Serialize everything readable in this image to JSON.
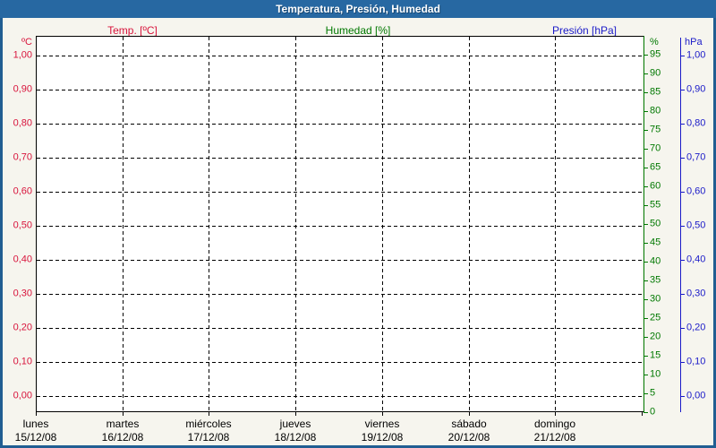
{
  "window": {
    "title": "Temperatura, Presión, Humedad"
  },
  "colors": {
    "titlebar": "#2768a2",
    "window_border": "#215e92",
    "background": "#f6f5ee",
    "plot_background": "#ffffff",
    "grid": "#000000",
    "temperature": "#d8143c",
    "humidity": "#007800",
    "pressure": "#1a1ac8"
  },
  "legend": {
    "items": [
      {
        "label": "Temp. [ºC]",
        "series": "temperature"
      },
      {
        "label": "Humedad [%]",
        "series": "humidity"
      },
      {
        "label": "Presión [hPa]",
        "series": "pressure"
      }
    ]
  },
  "chart_data": {
    "type": "line",
    "title": "Temperatura, Presión, Humedad",
    "grid": true,
    "series": [
      {
        "name": "Temp. [ºC]",
        "color": "#d8143c",
        "axis": "temperature",
        "values": []
      },
      {
        "name": "Humedad [%]",
        "color": "#007800",
        "axis": "humidity",
        "values": []
      },
      {
        "name": "Presión [hPa]",
        "color": "#1a1ac8",
        "axis": "pressure",
        "values": []
      }
    ],
    "axes": {
      "temperature": {
        "unit": "ºC",
        "side": "left",
        "min": 0.0,
        "max": 1.0,
        "step": 0.1,
        "ticks": [
          "1,00",
          "0,90",
          "0,80",
          "0,70",
          "0,60",
          "0,50",
          "0,40",
          "0,30",
          "0,20",
          "0,10",
          "0,00"
        ]
      },
      "humidity": {
        "unit": "%",
        "side": "right-inner",
        "min": 0,
        "max": 100,
        "step": 5,
        "ticks": [
          "95",
          "90",
          "85",
          "80",
          "75",
          "70",
          "65",
          "60",
          "55",
          "50",
          "45",
          "40",
          "35",
          "30",
          "25",
          "20",
          "15",
          "10",
          "5",
          "0"
        ]
      },
      "pressure": {
        "unit": "hPa",
        "side": "right-outer",
        "min": 0.0,
        "max": 1.0,
        "step": 0.1,
        "ticks": [
          "1,00",
          "0,90",
          "0,80",
          "0,70",
          "0,60",
          "0,50",
          "0,40",
          "0,30",
          "0,20",
          "0,10",
          "0,00"
        ]
      }
    },
    "x_axis": {
      "days": [
        {
          "name": "lunes",
          "date": "15/12/08"
        },
        {
          "name": "martes",
          "date": "16/12/08"
        },
        {
          "name": "miércoles",
          "date": "17/12/08"
        },
        {
          "name": "jueves",
          "date": "18/12/08"
        },
        {
          "name": "viernes",
          "date": "19/12/08"
        },
        {
          "name": "sábado",
          "date": "20/12/08"
        },
        {
          "name": "domingo",
          "date": "21/12/08"
        }
      ]
    }
  }
}
